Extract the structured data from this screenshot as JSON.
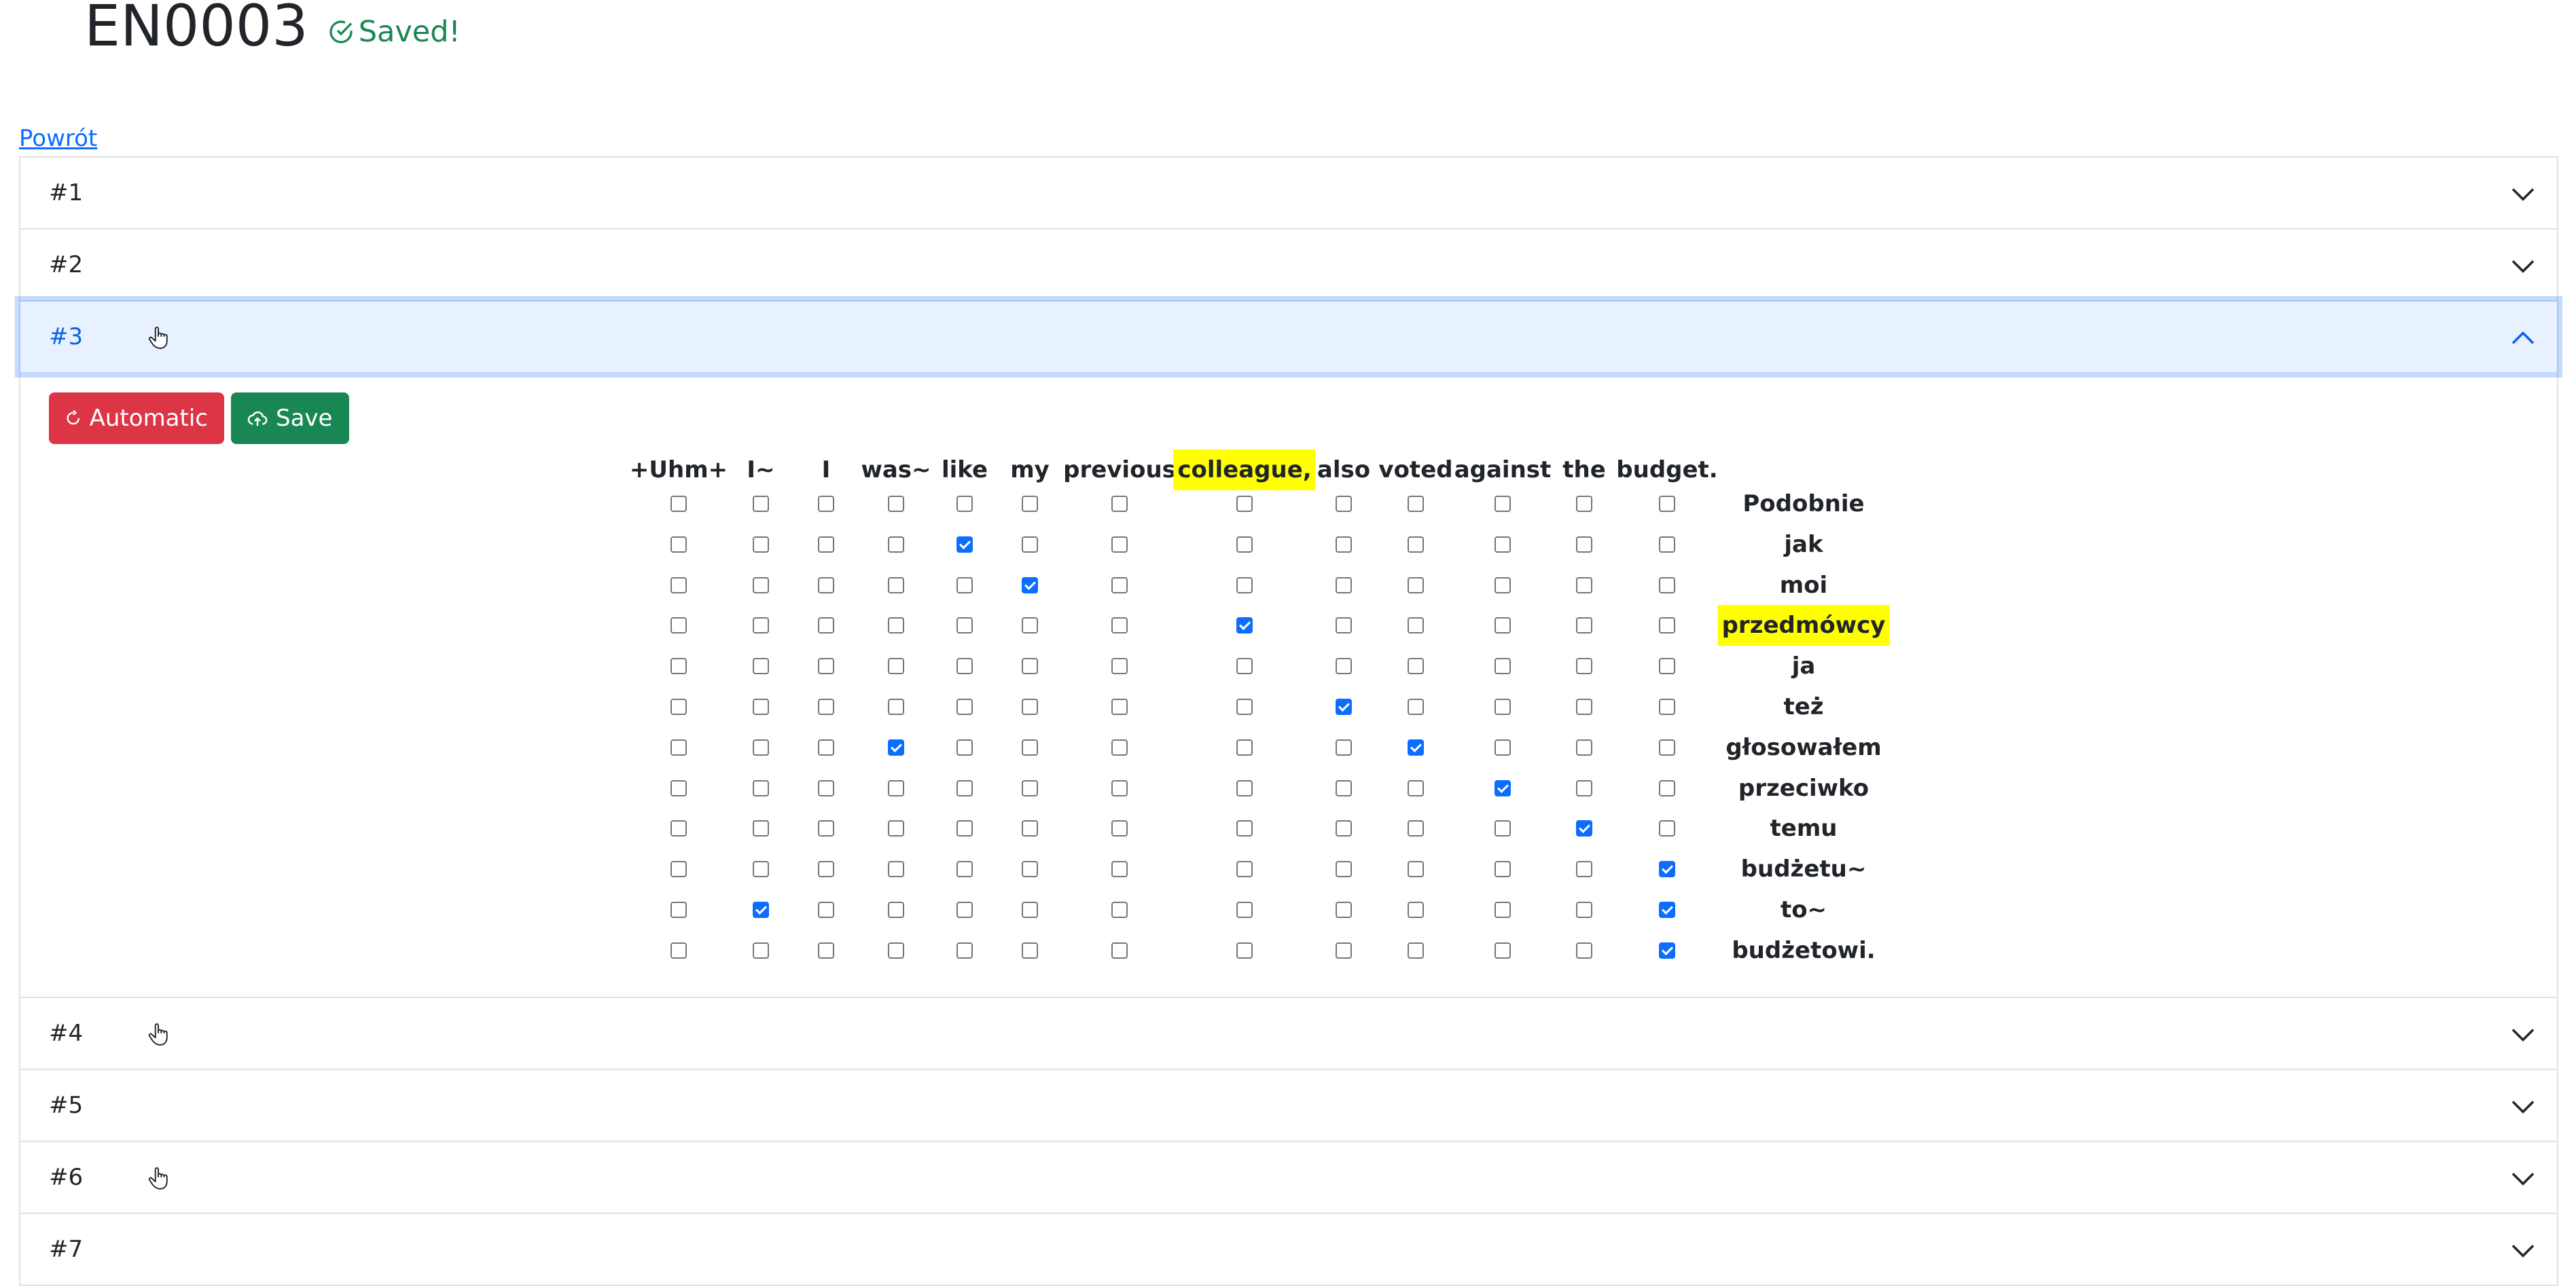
{
  "page": {
    "title": "EN0003",
    "saved_status": "Saved!",
    "back_link": "Powrót"
  },
  "accordion": {
    "items": [
      {
        "label": "#1",
        "expanded": false,
        "cursor": false
      },
      {
        "label": "#2",
        "expanded": false,
        "cursor": false
      },
      {
        "label": "#3",
        "expanded": true,
        "cursor": true
      },
      {
        "label": "#4",
        "expanded": false,
        "cursor": true
      },
      {
        "label": "#5",
        "expanded": false,
        "cursor": false
      },
      {
        "label": "#6",
        "expanded": false,
        "cursor": true
      },
      {
        "label": "#7",
        "expanded": false,
        "cursor": false
      }
    ]
  },
  "alignment": {
    "automatic_label": "Automatic",
    "save_label": "Save",
    "source_tokens": [
      "+Uhm+",
      "I~",
      "I",
      "was~",
      "like",
      "my",
      "previous",
      "colleague,",
      "also",
      "voted",
      "against",
      "the",
      "budget."
    ],
    "target_tokens": [
      "Podobnie",
      "jak",
      "moi",
      "przedmówcy",
      "ja",
      "też",
      "głosowałem",
      "przeciwko",
      "temu",
      "budżetu~",
      "to~",
      "budżetowi."
    ],
    "highlighted_source": [
      7
    ],
    "highlighted_target": [
      3
    ],
    "checked": [
      [
        1,
        4
      ],
      [
        2,
        5
      ],
      [
        3,
        7
      ],
      [
        5,
        8
      ],
      [
        6,
        3
      ],
      [
        6,
        9
      ],
      [
        7,
        10
      ],
      [
        8,
        11
      ],
      [
        9,
        12
      ],
      [
        10,
        1
      ],
      [
        10,
        12
      ],
      [
        11,
        12
      ]
    ]
  },
  "colors": {
    "accent": "#0d6efd",
    "danger": "#dc3545",
    "success": "#198754",
    "highlight": "#ffff00"
  },
  "icons": [
    "check-circle-icon",
    "pointer-cursor-icon",
    "chevron-down-icon",
    "chevron-up-icon",
    "refresh-icon",
    "cloud-upload-icon"
  ]
}
